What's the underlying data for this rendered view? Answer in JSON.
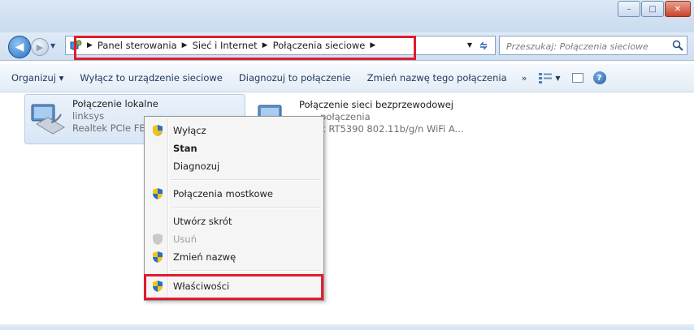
{
  "window": {
    "caption_buttons": {
      "minimize": "–",
      "maximize": "□",
      "close": "✕"
    }
  },
  "nav": {
    "back_label": "◀",
    "forward_label": "▶",
    "breadcrumbs": [
      "Panel sterowania",
      "Sieć i Internet",
      "Połączenia sieciowe"
    ],
    "separator": "▶",
    "search_placeholder": "Przeszukaj: Połączenia sieciowe"
  },
  "toolbar": {
    "organize": "Organizuj ▾",
    "disable_device": "Wyłącz to urządzenie sieciowe",
    "diagnose": "Diagnozuj to połączenie",
    "rename": "Zmień nazwę tego połączenia",
    "more": "»"
  },
  "connections": [
    {
      "name": "Połączenie lokalne",
      "status": "linksys",
      "device": "Realtek PCIe FE"
    },
    {
      "name": "Połączenie sieci bezprzewodowej",
      "status": "połączenia",
      "device": "k RT5390 802.11b/g/n WiFi A..."
    }
  ],
  "context_menu": {
    "items": [
      {
        "label": "Wyłącz",
        "shield": true,
        "bold": false,
        "disabled": false
      },
      {
        "label": "Stan",
        "shield": false,
        "bold": true,
        "disabled": false
      },
      {
        "label": "Diagnozuj",
        "shield": false,
        "bold": false,
        "disabled": false
      },
      {
        "label": "Połączenia mostkowe",
        "shield": true,
        "bold": false,
        "disabled": false
      },
      {
        "label": "Utwórz skrót",
        "shield": false,
        "bold": false,
        "disabled": false
      },
      {
        "label": "Usuń",
        "shield": true,
        "bold": false,
        "disabled": true
      },
      {
        "label": "Zmień nazwę",
        "shield": true,
        "bold": false,
        "disabled": false
      },
      {
        "label": "Właściwości",
        "shield": true,
        "bold": false,
        "disabled": false
      }
    ]
  },
  "colors": {
    "highlight_box": "#e01b2e",
    "accent": "#2a6fc0"
  }
}
